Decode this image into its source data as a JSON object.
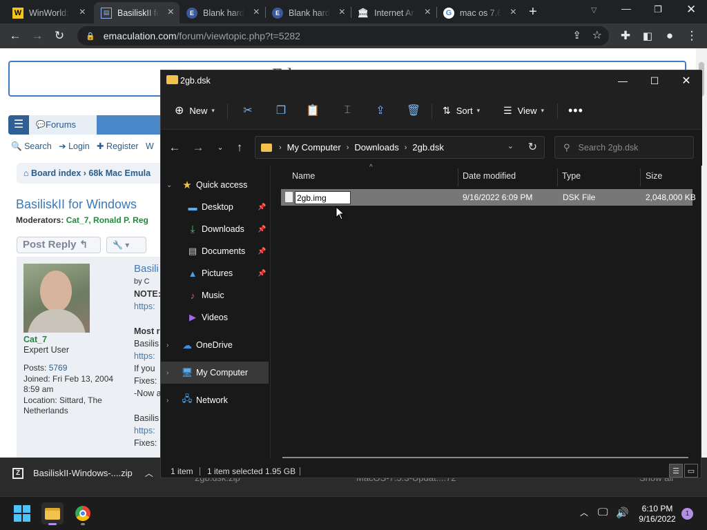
{
  "browser": {
    "tabs": [
      {
        "title": "WinWorld:",
        "icon": "winworld-icon"
      },
      {
        "title": "BasiliskII fo",
        "icon": "emaculation-icon"
      },
      {
        "title": "Blank hard",
        "icon": "emaculation-icon"
      },
      {
        "title": "Blank hard",
        "icon": "emaculation-icon"
      },
      {
        "title": "Internet Ar",
        "icon": "archive-icon"
      },
      {
        "title": "mac os 7.6",
        "icon": "google-icon"
      }
    ],
    "url_domain": "emaculation.com",
    "url_path": "/forum/viewtopic.php?t=5282"
  },
  "forum": {
    "banner_text": "E       l  t",
    "forums_label": "Forums",
    "search_label": "Search",
    "login_label": "Login",
    "register_label": "Register",
    "register_extra": "W",
    "breadcrumb": "Board index  ›  68k Mac Emula",
    "page_title": "BasiliskII for Windows",
    "moderators_label": "Moderators:",
    "moderators": "Cat_7, Ronald P. Reg",
    "post_reply": "Post Reply",
    "user": {
      "name": "Cat_7",
      "rank": "Expert User",
      "posts_label": "Posts:",
      "posts": "5769",
      "joined": "Joined: Fri Feb 13, 2004 8:59 am",
      "location": "Location: Sittard, The Netherlands"
    },
    "post_lines": [
      "Basili",
      "by C",
      "NOTE:",
      "https:",
      "",
      "Most r",
      "Basilis",
      "https:",
      "If you",
      "Fixes:",
      "-Now a",
      "",
      "Basilis",
      "https:",
      "Fixes:"
    ]
  },
  "downloads_bar": {
    "file": "BasiliskII-Windows-....zip",
    "behind_items": [
      "2gb.dsk.zip",
      "MacOS-7.5.3-Updat....72",
      "Show all"
    ]
  },
  "explorer": {
    "window_title": "2gb.dsk",
    "commands": {
      "new": "New",
      "sort": "Sort",
      "view": "View"
    },
    "breadcrumb": [
      "My Computer",
      "Downloads",
      "2gb.dsk"
    ],
    "search_placeholder": "Search 2gb.dsk",
    "nav": {
      "quick_access": "Quick access",
      "desktop": "Desktop",
      "downloads": "Downloads",
      "documents": "Documents",
      "pictures": "Pictures",
      "music": "Music",
      "videos": "Videos",
      "onedrive": "OneDrive",
      "my_computer": "My Computer",
      "network": "Network"
    },
    "columns": {
      "name": "Name",
      "date": "Date modified",
      "type": "Type",
      "size": "Size"
    },
    "file": {
      "rename_value": "2gb.img",
      "date": "9/16/2022 6:09 PM",
      "type": "DSK File",
      "size": "2,048,000 KB"
    },
    "status": {
      "items": "1 item",
      "selected": "1 item selected  1.95 GB"
    }
  },
  "taskbar": {
    "time": "6:10 PM",
    "date": "9/16/2022",
    "notifications": "1"
  }
}
